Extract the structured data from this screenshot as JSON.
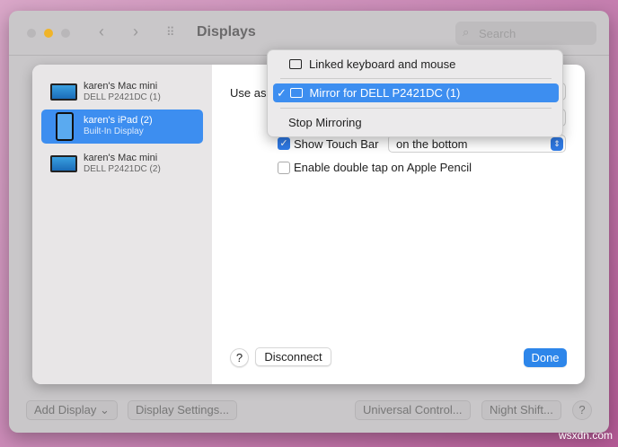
{
  "window": {
    "title": "Displays",
    "search_placeholder": "Search"
  },
  "sidebar": {
    "items": [
      {
        "name": "karen's Mac mini",
        "sub": "DELL P2421DC (1)"
      },
      {
        "name": "karen's iPad (2)",
        "sub": "Built-In Display"
      },
      {
        "name": "karen's Mac mini",
        "sub": "DELL P2421DC (2)"
      }
    ]
  },
  "settings": {
    "use_as_label": "Use as",
    "show_touch_bar": "Show Touch Bar",
    "touch_bar_position": "on the bottom",
    "double_tap": "Enable double tap on Apple Pencil"
  },
  "menu": {
    "items": [
      "Linked keyboard and mouse",
      "Mirror for DELL P2421DC (1)",
      "Stop Mirroring"
    ],
    "checkmark": "✓"
  },
  "sheet": {
    "help": "?",
    "disconnect": "Disconnect",
    "done": "Done"
  },
  "toolbar": {
    "add_display": "Add Display",
    "display_settings": "Display Settings...",
    "universal_control": "Universal Control...",
    "night_shift": "Night Shift...",
    "help": "?"
  },
  "watermark": "wsxdn.com"
}
